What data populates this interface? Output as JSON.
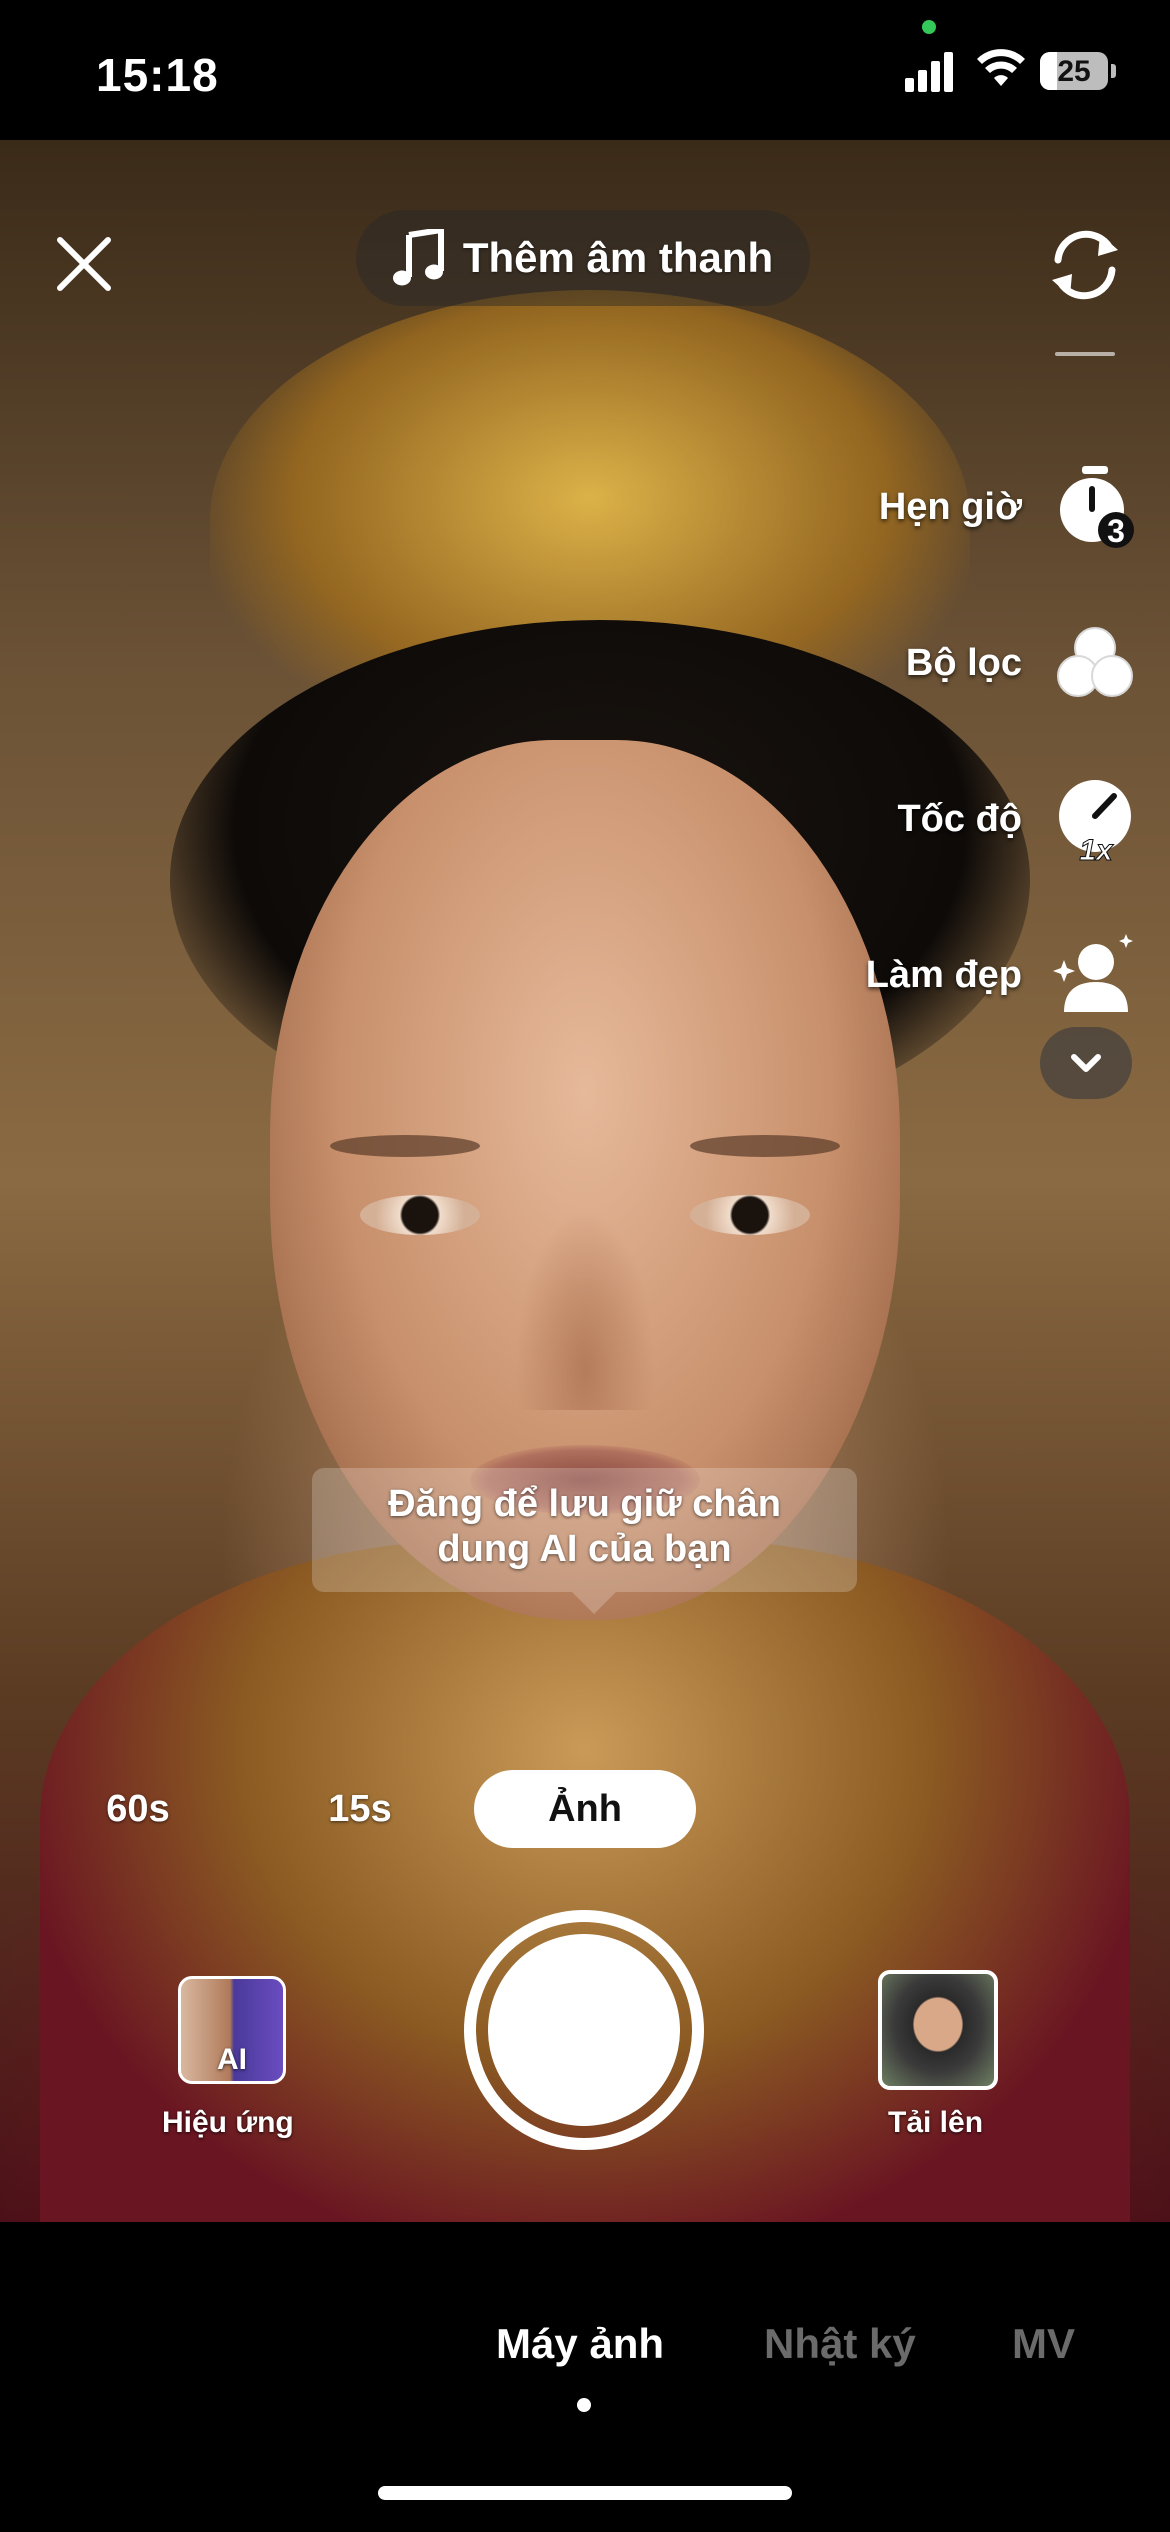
{
  "status_bar": {
    "time": "15:18",
    "battery_percent": "25",
    "battery_level": 0.25
  },
  "top_bar": {
    "close_icon": "close-icon",
    "add_sound_label": "Thêm âm thanh",
    "flip_icon": "flip-camera-icon"
  },
  "side_tools": [
    {
      "label": "Hẹn giờ",
      "icon": "timer-icon",
      "badge": "3"
    },
    {
      "label": "Bộ lọc",
      "icon": "filters-icon"
    },
    {
      "label": "Tốc độ",
      "icon": "speed-icon",
      "badge": "1x"
    },
    {
      "label": "Làm đẹp",
      "icon": "beauty-icon"
    }
  ],
  "tooltip": {
    "line1": "Đăng để lưu giữ chân",
    "line2": "dung AI của bạn"
  },
  "capture_modes": [
    {
      "label": "60s",
      "active": false
    },
    {
      "label": "15s",
      "active": false
    },
    {
      "label": "Ảnh",
      "active": true
    }
  ],
  "bottom_controls": {
    "effects_label": "Hiệu ứng",
    "effects_badge": "AI",
    "upload_label": "Tải lên"
  },
  "tabs": [
    {
      "label": "Máy ảnh",
      "active": true
    },
    {
      "label": "Nhật ký",
      "active": false
    },
    {
      "label": "MV",
      "active": false
    }
  ],
  "colors": {
    "accent": "#ffffff",
    "inactive_tab": "#6b6b6b",
    "status_green": "#34c759"
  }
}
